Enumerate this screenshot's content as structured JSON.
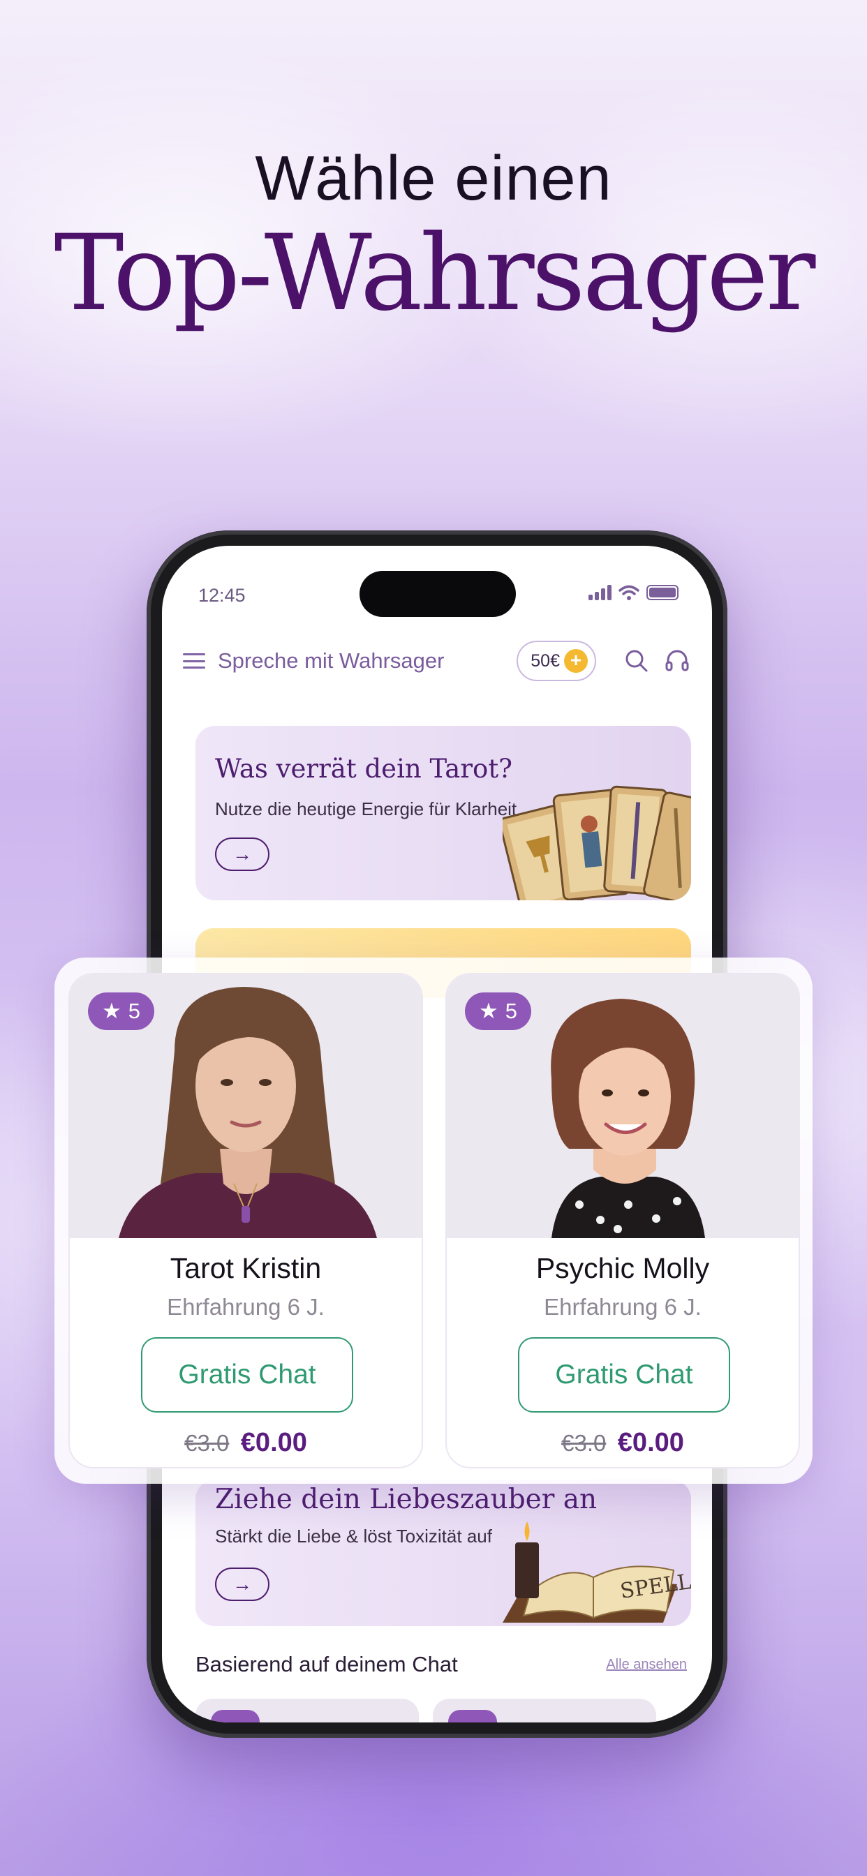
{
  "headline": {
    "line1": "Wähle einen",
    "line2": "Top-Wahrsager"
  },
  "status_bar": {
    "time": "12:45"
  },
  "app_header": {
    "title": "Spreche mit Wahrsager",
    "balance": "50€",
    "plus": "+"
  },
  "promo_tarot": {
    "title": "Was verrät dein Tarot?",
    "subtitle": "Nutze die heutige Energie für Klarheit",
    "arrow": "→"
  },
  "promo_love": {
    "title": "Ziehe dein Liebeszauber an",
    "subtitle": "Stärkt die Liebe & löst Toxizität auf",
    "arrow": "→",
    "book_text": "SPELL"
  },
  "section": {
    "title": "Basierend auf deinem Chat",
    "see_all": "Alle ansehen"
  },
  "advisors": [
    {
      "rating": "5",
      "name": "Tarot Kristin",
      "experience": "Ehrfahrung 6 J.",
      "button": "Gratis Chat",
      "old_price": "€3.0",
      "new_price": "€0.00"
    },
    {
      "rating": "5",
      "name": "Psychic Molly",
      "experience": "Ehrfahrung 6 J.",
      "button": "Gratis Chat",
      "old_price": "€3.0",
      "new_price": "€0.00"
    }
  ],
  "colors": {
    "brand_purple": "#4c1269",
    "rating_badge": "#8e57b8",
    "chat_green": "#2f9a72",
    "coin_yellow": "#f5b931"
  },
  "icons": [
    "menu-icon",
    "search-icon",
    "headset-icon",
    "star-icon",
    "arrow-right-icon",
    "signal-icon",
    "wifi-icon",
    "battery-icon"
  ]
}
